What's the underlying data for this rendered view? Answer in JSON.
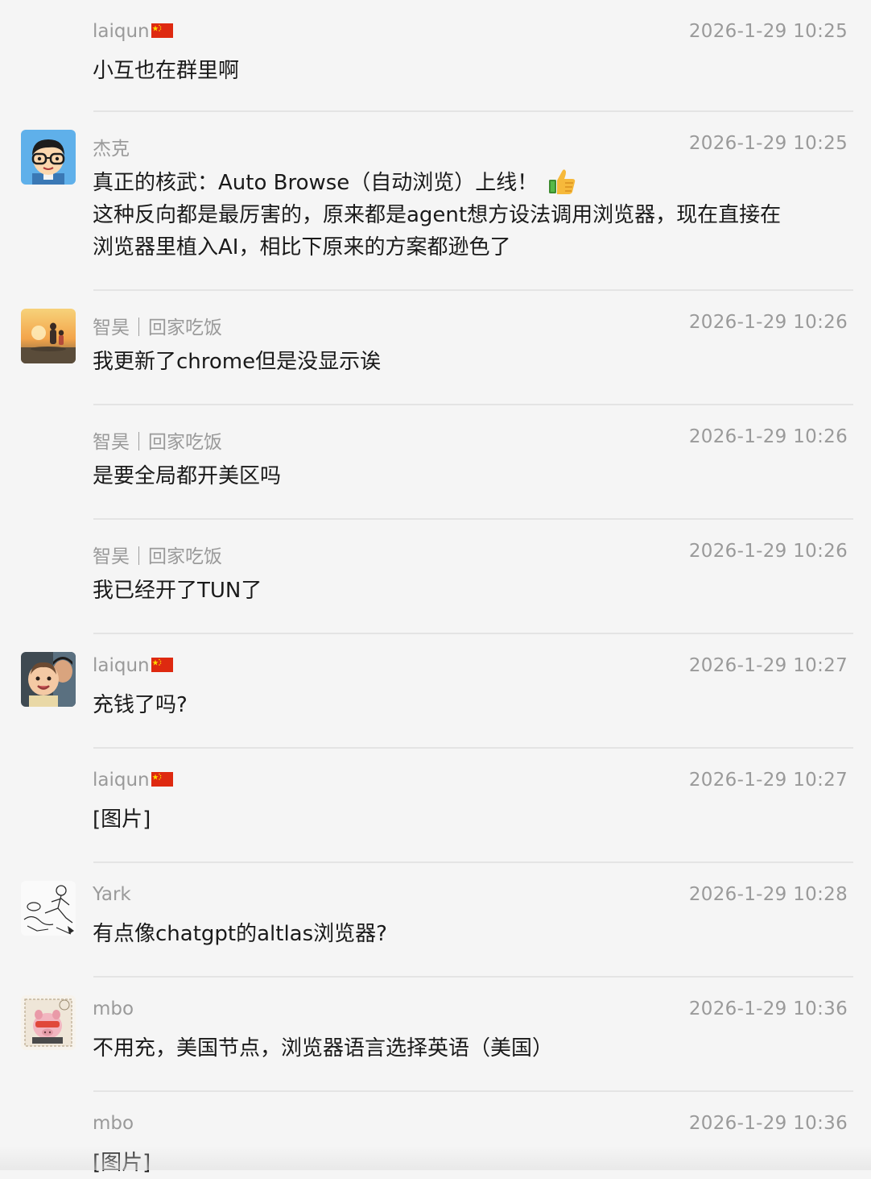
{
  "messages": [
    {
      "sender": "laiqun",
      "sender_flag": "china-flag",
      "time": "2026-1-29 10:25",
      "avatar": null,
      "lines": [
        "小互也在群里啊"
      ]
    },
    {
      "sender": "杰克",
      "time": "2026-1-29 10:25",
      "avatar": "cartoon-boy-glasses",
      "lines": [
        "真正的核武：Auto Browse（自动浏览）上线！",
        "这种反向都是最厉害的，原来都是agent想方设法调用浏览器，现在直接在",
        "浏览器里植入AI，相比下原来的方案都逊色了"
      ],
      "emoji": "thumbs-up-emoji"
    },
    {
      "sender": "智昊｜回家吃饭",
      "time": "2026-1-29 10:26",
      "avatar": "sunset-beach-photo",
      "lines": [
        "我更新了chrome但是没显示诶"
      ]
    },
    {
      "sender": "智昊｜回家吃饭",
      "time": "2026-1-29 10:26",
      "avatar": null,
      "lines": [
        "是要全局都开美区吗"
      ]
    },
    {
      "sender": "智昊｜回家吃饭",
      "time": "2026-1-29 10:26",
      "avatar": null,
      "lines": [
        "我已经开了TUN了"
      ]
    },
    {
      "sender": "laiqun",
      "sender_flag": "china-flag",
      "time": "2026-1-29 10:27",
      "avatar": "baby-photo",
      "lines": [
        "充钱了吗?"
      ]
    },
    {
      "sender": "laiqun",
      "sender_flag": "china-flag",
      "time": "2026-1-29 10:27",
      "avatar": null,
      "lines": [
        "[图片]"
      ]
    },
    {
      "sender": "Yark",
      "time": "2026-1-29 10:28",
      "avatar": "line-sketch",
      "lines": [
        "有点像chatgpt的altlas浏览器?"
      ]
    },
    {
      "sender": "mbo",
      "time": "2026-1-29 10:36",
      "avatar": "stamp-pig",
      "lines": [
        "不用充，美国节点，浏览器语言选择英语（美国）"
      ]
    },
    {
      "sender": "mbo",
      "time": "2026-1-29 10:36",
      "avatar": null,
      "lines": [
        "[图片]"
      ]
    }
  ]
}
